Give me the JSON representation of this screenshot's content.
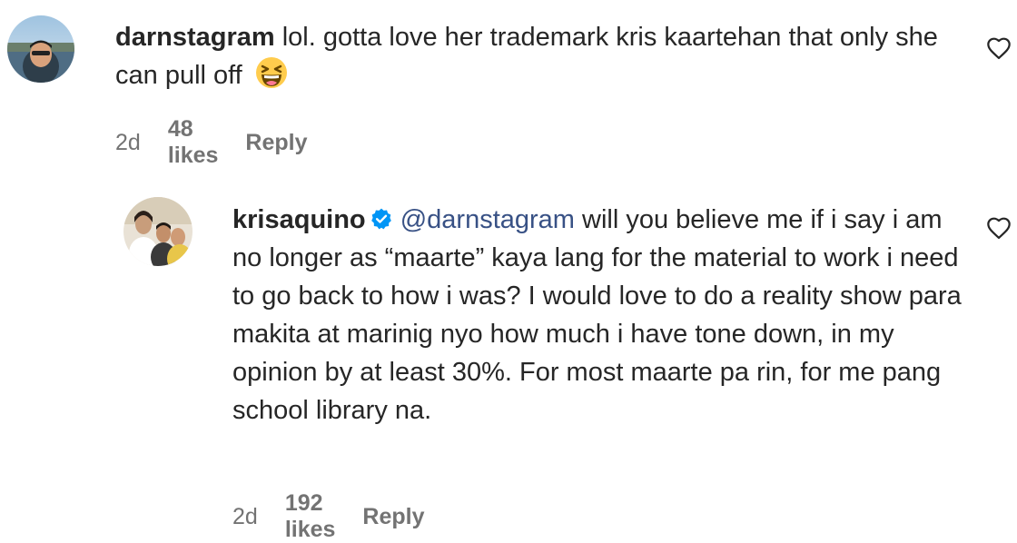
{
  "comments": [
    {
      "username": "darnstagram",
      "verified": false,
      "text": "lol. gotta love her trademark kris kaartehan that only she can pull off",
      "emoji": "laughing-squinting-face",
      "time": "2d",
      "likes": "48 likes",
      "reply_label": "Reply"
    }
  ],
  "reply": {
    "username": "krisaquino",
    "verified": true,
    "mention": "@darnstagram",
    "text": "will you believe me if i say i am no longer as “maarte” kaya lang for the material to work i need to go back to how i was? I would love to do a reality show para makita at marinig nyo how much i have tone down, in my opinion by at least 30%. For most maarte pa rin, for me pang school library na.",
    "time": "2d",
    "likes": "192 likes",
    "reply_label": "Reply"
  },
  "colors": {
    "text": "#262626",
    "secondary": "#737373",
    "mention": "#385185",
    "verified": "#0095f6"
  }
}
